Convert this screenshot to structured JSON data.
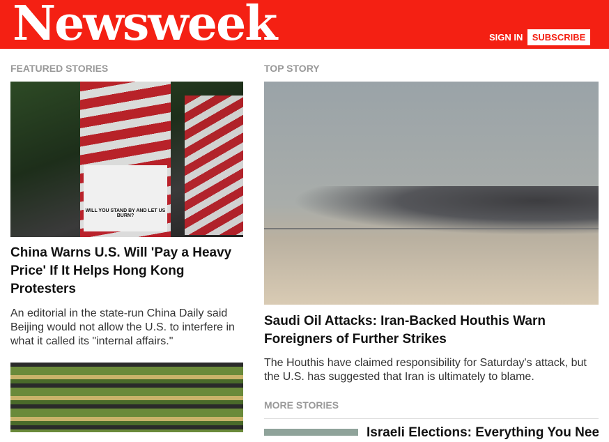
{
  "header": {
    "logo": "Newsweek",
    "sign_in": "SIGN IN",
    "subscribe": "SUBSCRIBE",
    "brand_color": "#f42013"
  },
  "featured": {
    "label": "FEATURED STORIES",
    "stories": [
      {
        "title": "China Warns U.S. Will 'Pay a Heavy Price' If It Helps Hong Kong Protesters",
        "summary": "An editorial in the state-run China Daily said Beijing would not allow the U.S. to interfere in what it called its \"internal affairs.\"",
        "sign_text": "WILL YOU STAND BY AND LET US BURN?"
      },
      {
        "title": ""
      }
    ]
  },
  "top_story": {
    "label": "TOP STORY",
    "title": "Saudi Oil Attacks: Iran-Backed Houthis Warn Foreigners of Further Strikes",
    "summary": "The Houthis have claimed responsibility for Saturday's attack, but the U.S. has suggested that Iran is ultimately to blame."
  },
  "more": {
    "label": "MORE STORIES",
    "stories": [
      {
        "title": "Israeli Elections: Everything You Need to Know"
      }
    ]
  }
}
